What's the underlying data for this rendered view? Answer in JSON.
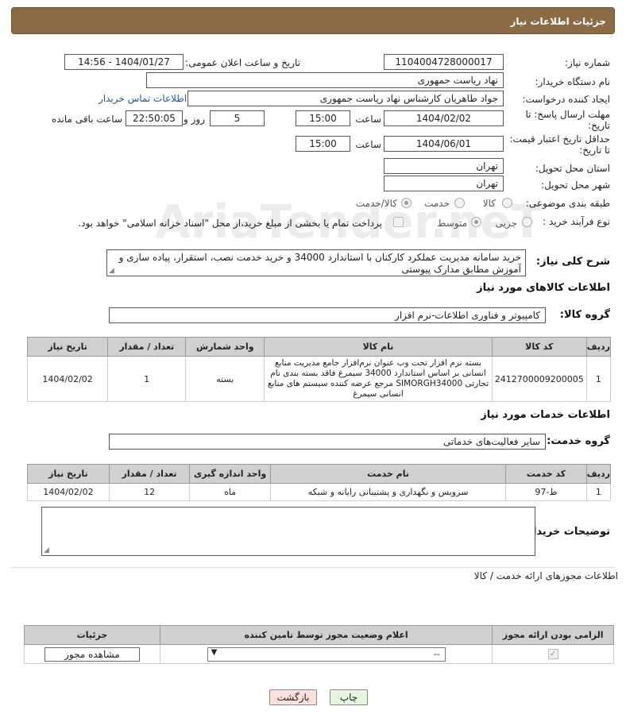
{
  "header": {
    "title": "جزئیات اطلاعات نیاز"
  },
  "watermark": "AriaTender.neT",
  "fields": {
    "need_number": {
      "label": "شماره نیاز:",
      "value": "1104004728000017"
    },
    "announce_datetime": {
      "label": "تاریخ و ساعت اعلان عمومی:",
      "value": "1404/01/27 - 14:56"
    },
    "buyer_org": {
      "label": "نام دستگاه خریدار:",
      "value": "نهاد ریاست جمهوری"
    },
    "requester": {
      "label": "ایجاد کننده درخواست:",
      "value": "جواد طاهریان کارشناس نهاد ریاست جمهوری"
    },
    "buyer_contact_link": "اطلاعات تماس خریدار",
    "reply_deadline": {
      "label_line1": "مهلت ارسال پاسخ: تا",
      "label_line2": "تاریخ:",
      "date": "1404/02/02",
      "time_label": "ساعت",
      "time": "15:00",
      "days": "5",
      "days_label": "روز و",
      "remaining": "22:50:05",
      "remaining_label": "ساعت باقی مانده"
    },
    "price_validity": {
      "label_line1": "حداقل تاریخ اعتبار قیمت:",
      "label_line2": "تا تاریخ:",
      "date": "1404/06/01",
      "time_label": "ساعت",
      "time": "15:00"
    },
    "province": {
      "label": "استان محل تحویل:",
      "value": "تهران"
    },
    "city": {
      "label": "شهر محل تحویل:",
      "value": "تهران"
    },
    "category": {
      "label": "طبقه بندی موضوعی:",
      "options": [
        "کالا",
        "خدمت",
        "کالا/خدمت"
      ],
      "selected": "کالا/خدمت"
    },
    "process_type": {
      "label": "نوع فرآیند خرید :",
      "options": [
        "جزیی",
        "متوسط"
      ],
      "selected": "متوسط",
      "payment_note": "پرداخت تمام یا بخشی از مبلغ خرید،از محل \"اسناد خزانه اسلامی\" خواهد بود."
    },
    "description": {
      "label": "شرح کلی نیاز:",
      "value": "خرید سامانه مدیریت عملکرد کارکنان با استاندارد 34000 و خرید خدمت نصب، استقرار، پیاده سازی و آموزش مطابق مدارک پیوستی"
    }
  },
  "goods_section": {
    "title": "اطلاعات کالاهای مورد نیاز",
    "group_label": "گروه کالا:",
    "group_value": "کامپیوتر و فناوری اطلاعات-نرم افزار",
    "columns": [
      "ردیف",
      "کد کالا",
      "نام کالا",
      "واحد شمارش",
      "تعداد / مقدار",
      "تاریخ نیاز"
    ],
    "rows": [
      [
        "1",
        "2412700009200005",
        "بسته نرم افزار تحت وب عنوان نرم‌افزار جامع مدیریت منابع انسانی بر اساس استاندارد 34000 سیمرغ فاقد بسته بندی نام تجارتی SIMORGH34000 مرجع عرضه کننده سیستم های منابع انسانی سیمرغ",
        "بسته",
        "1",
        "1404/02/02"
      ]
    ]
  },
  "services_section": {
    "title": "اطلاعات خدمات مورد نیاز",
    "group_label": "گروه خدمت:",
    "group_value": "سایر فعالیت‌های خدماتی",
    "columns": [
      "ردیف",
      "کد خدمت",
      "نام خدمت",
      "واحد اندازه گیری",
      "تعداد / مقدار",
      "تاریخ نیاز"
    ],
    "rows": [
      [
        "1",
        "ط-97",
        "سرویس و نگهداری و پشتیبانی رایانه و شبکه",
        "ماه",
        "12",
        "1404/02/02"
      ]
    ]
  },
  "buyer_notes": {
    "label": "توضیحات خریدار:",
    "value": ""
  },
  "licenses": {
    "title": "اطلاعات مجوزهای ارائه خدمت / کالا",
    "columns": [
      "الزامی بودن ارائه مجوز",
      "اعلام وضعیت مجوز توسط تامین کننده",
      "جزئیات"
    ],
    "select_value": "--",
    "view_button": "مشاهده مجوز"
  },
  "buttons": {
    "print": "چاپ",
    "back": "بازگشت"
  },
  "colors": {
    "header": "#8b6b45",
    "link": "#1a57a8",
    "back_button": "#fde0e0",
    "print_button": "#e6f5dd"
  }
}
